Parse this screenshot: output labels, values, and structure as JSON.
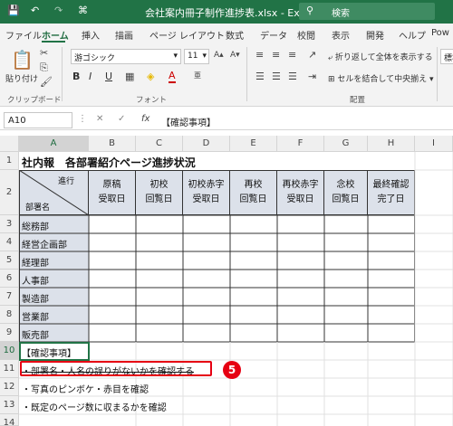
{
  "titlebar": {
    "filename": "会社案内冊子制作進捗表.xlsx",
    "sep": "-",
    "app": "Excel",
    "search_placeholder": "検索",
    "quick_access": [
      "💾",
      "↶",
      "↷",
      "⌘"
    ]
  },
  "tabs": [
    "ファイル",
    "ホーム",
    "挿入",
    "描画",
    "ページ レイアウト",
    "数式",
    "データ",
    "校閲",
    "表示",
    "開発",
    "ヘルプ",
    "Pow"
  ],
  "active_tab": "ホーム",
  "ribbon": {
    "paste_label": "貼り付け",
    "clipboard_group": "クリップボード",
    "font_name": "游ゴシック",
    "font_size": "11",
    "font_group": "フォント",
    "bold": "B",
    "italic": "I",
    "underline": "U",
    "font_color_glyph": "A",
    "wrap_text": "折り返して全体を表示する",
    "merge_center": "セルを結合して中央揃え",
    "alignment_group": "配置",
    "style_box": "標準"
  },
  "formula_bar": {
    "name_box": "A10",
    "fx": "fx",
    "value": "【確認事項】"
  },
  "columns": [
    "A",
    "B",
    "C",
    "D",
    "E",
    "F",
    "G",
    "H",
    "I"
  ],
  "rows": [
    "1",
    "2",
    "3",
    "4",
    "5",
    "6",
    "7",
    "8",
    "9",
    "10",
    "11",
    "12",
    "13",
    "14"
  ],
  "sheet": {
    "title": "社内報　各部署紹介ページ進捗状況",
    "corner_top": "進行",
    "corner_bottom": "部署名",
    "headers": [
      [
        "原稿",
        "受取日"
      ],
      [
        "初校",
        "回覧日"
      ],
      [
        "初校赤字",
        "受取日"
      ],
      [
        "再校",
        "回覧日"
      ],
      [
        "再校赤字",
        "受取日"
      ],
      [
        "念校",
        "回覧日"
      ],
      [
        "最終確認",
        "完了日"
      ]
    ],
    "departments": [
      "総務部",
      "経営企画部",
      "経理部",
      "人事部",
      "製造部",
      "営業部",
      "販売部"
    ],
    "note_title": "【確認事項】",
    "notes": [
      "・部署名・人名の誤りがないかを確認する",
      "・写真のピンボケ・赤目を確認",
      "・既定のページ数に収まるかを確認"
    ]
  },
  "callout_number": "5",
  "colors": {
    "excel_green": "#217346",
    "header_fill": "#dce1ea",
    "callout_red": "#e60012"
  }
}
